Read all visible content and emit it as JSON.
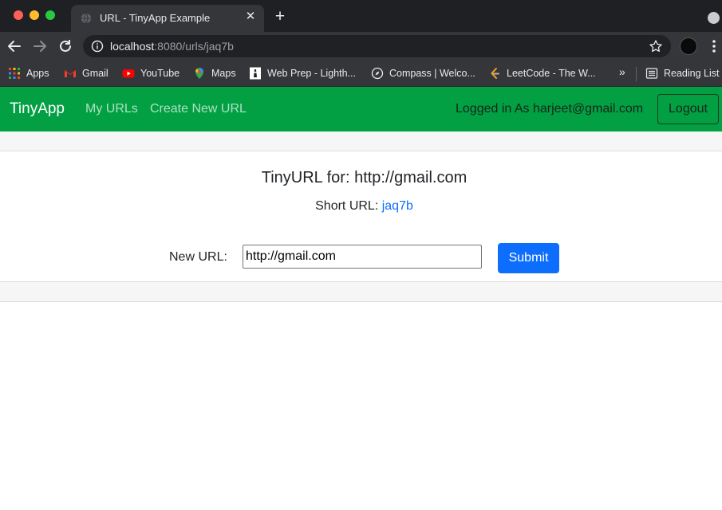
{
  "browser": {
    "tab_title": "URL - TinyApp Example",
    "tab_close": "✕",
    "new_tab": "+",
    "url_host": "localhost",
    "url_rest": ":8080/urls/jaq7b",
    "bookmarks": [
      {
        "label": "Apps",
        "icon": "apps-grid-icon"
      },
      {
        "label": "Gmail",
        "icon": "gmail-icon"
      },
      {
        "label": "YouTube",
        "icon": "youtube-icon"
      },
      {
        "label": "Maps",
        "icon": "maps-icon"
      },
      {
        "label": "Web Prep - Lighth...",
        "icon": "lighthouse-icon"
      },
      {
        "label": "Compass | Welco...",
        "icon": "compass-icon"
      },
      {
        "label": "LeetCode - The W...",
        "icon": "leetcode-icon"
      }
    ],
    "bookmarks_more": "»",
    "reading_list": "Reading List"
  },
  "navbar": {
    "brand": "TinyApp",
    "links": [
      "My URLs",
      "Create New URL"
    ],
    "logged_in": "Logged in As harjeet@gmail.com",
    "logout": "Logout",
    "color": "#02a043"
  },
  "main": {
    "heading": "TinyURL for: http://gmail.com",
    "short_url_label": "Short URL: ",
    "short_url_value": "jaq7b",
    "form": {
      "label": "New URL:",
      "value": "http://gmail.com",
      "submit": "Submit"
    }
  }
}
